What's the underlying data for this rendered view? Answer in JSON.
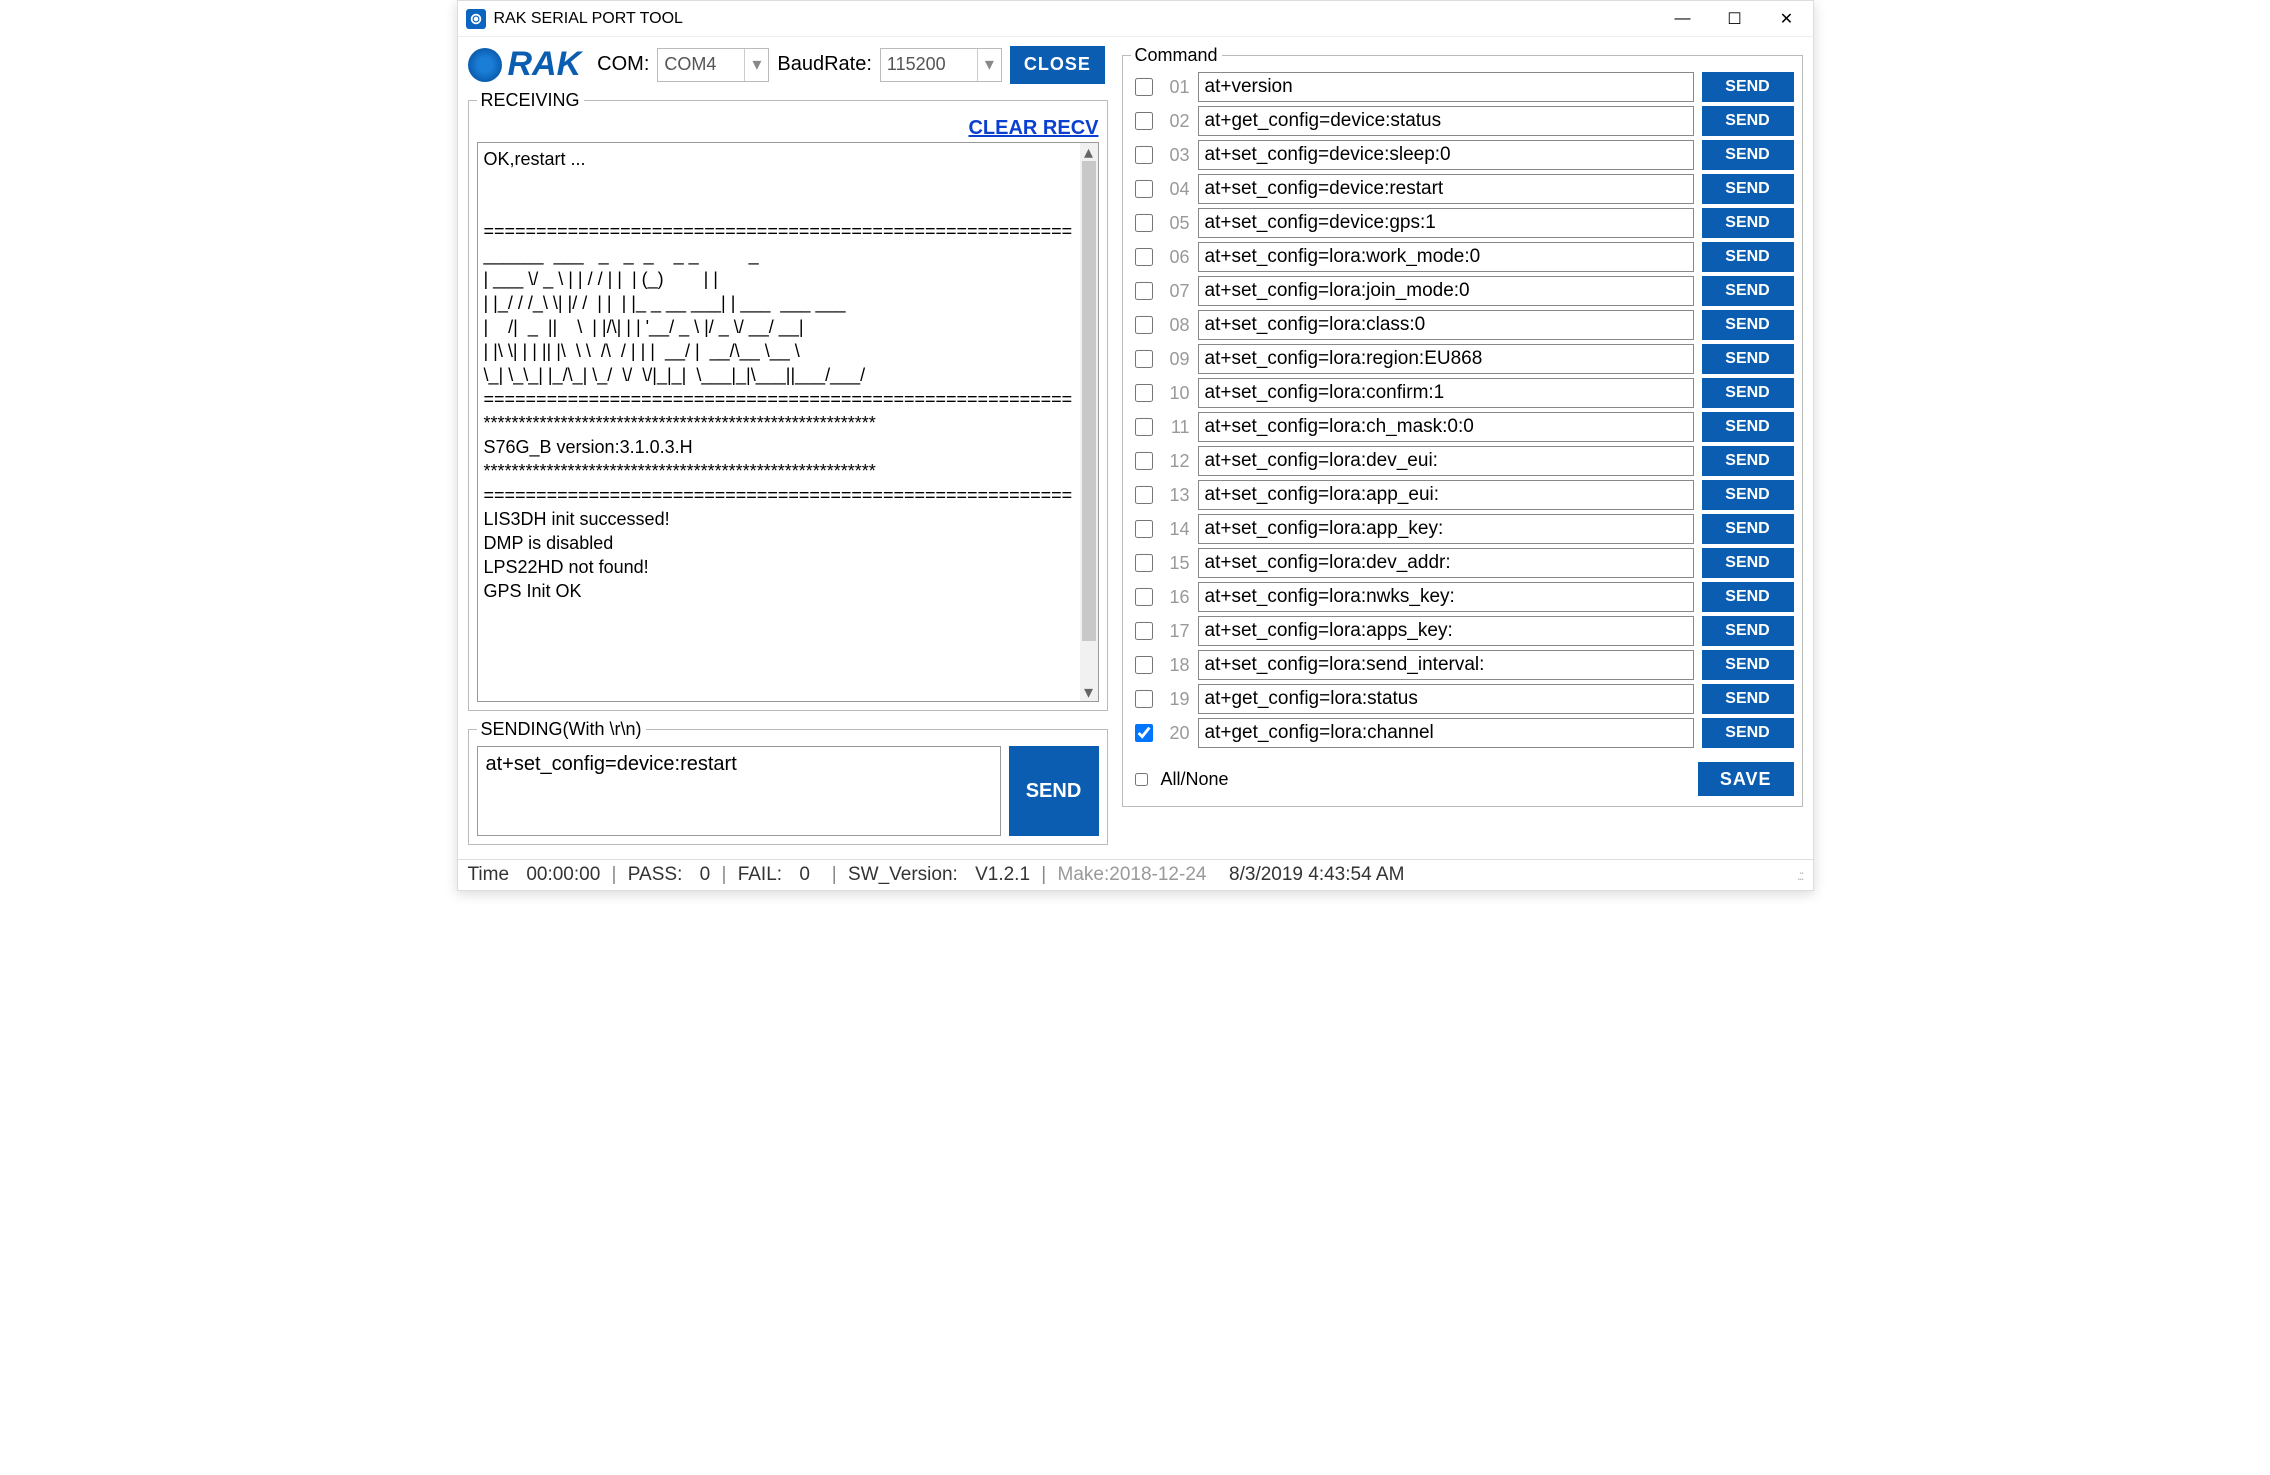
{
  "window": {
    "title": "RAK SERIAL PORT TOOL"
  },
  "toolbar": {
    "logo_text": "RAK",
    "com_label": "COM:",
    "com_value": "COM4",
    "baud_label": "BaudRate:",
    "baud_value": "115200",
    "close_label": "CLOSE"
  },
  "receiving": {
    "legend": "RECEIVING",
    "clear_label": "CLEAR RECV",
    "text": "OK,restart ...\n\n\n========================================================\n______  ___   _   _  _    _ _          _\n| ___ \\/ _ \\ | | / / | |  | (_)        | |\n| |_/ / /_\\ \\| |/ /  | |  | |_ _ __ ___| | ___  ___ ___\n|    /|  _  ||    \\  | |/\\| | | '__/ _ \\ |/ _ \\/ __/ __|\n| |\\ \\| | | || |\\  \\ \\  /\\  / | | |  __/ |  __/\\__ \\__ \\\n\\_| \\_\\_| |_/\\_| \\_/  \\/  \\/|_|_|  \\___|_|\\___||___/___/\n========================================================\n********************************************************\nS76G_B version:3.1.0.3.H\n********************************************************\n========================================================\nLIS3DH init successed!\nDMP is disabled\nLPS22HD not found!\nGPS Init OK"
  },
  "sending": {
    "legend": "SENDING(With \\r\\n)",
    "value": "at+set_config=device:restart",
    "send_label": "SEND"
  },
  "commands": {
    "legend": "Command",
    "send_label": "SEND",
    "all_none_label": "All/None",
    "save_label": "SAVE",
    "items": [
      {
        "n": "01",
        "checked": false,
        "cmd": "at+version"
      },
      {
        "n": "02",
        "checked": false,
        "cmd": "at+get_config=device:status"
      },
      {
        "n": "03",
        "checked": false,
        "cmd": "at+set_config=device:sleep:0"
      },
      {
        "n": "04",
        "checked": false,
        "cmd": "at+set_config=device:restart"
      },
      {
        "n": "05",
        "checked": false,
        "cmd": "at+set_config=device:gps:1"
      },
      {
        "n": "06",
        "checked": false,
        "cmd": "at+set_config=lora:work_mode:0"
      },
      {
        "n": "07",
        "checked": false,
        "cmd": "at+set_config=lora:join_mode:0"
      },
      {
        "n": "08",
        "checked": false,
        "cmd": "at+set_config=lora:class:0"
      },
      {
        "n": "09",
        "checked": false,
        "cmd": "at+set_config=lora:region:EU868"
      },
      {
        "n": "10",
        "checked": false,
        "cmd": "at+set_config=lora:confirm:1"
      },
      {
        "n": "11",
        "checked": false,
        "cmd": "at+set_config=lora:ch_mask:0:0"
      },
      {
        "n": "12",
        "checked": false,
        "cmd": "at+set_config=lora:dev_eui:"
      },
      {
        "n": "13",
        "checked": false,
        "cmd": "at+set_config=lora:app_eui:"
      },
      {
        "n": "14",
        "checked": false,
        "cmd": "at+set_config=lora:app_key:"
      },
      {
        "n": "15",
        "checked": false,
        "cmd": "at+set_config=lora:dev_addr:"
      },
      {
        "n": "16",
        "checked": false,
        "cmd": "at+set_config=lora:nwks_key:"
      },
      {
        "n": "17",
        "checked": false,
        "cmd": "at+set_config=lora:apps_key:"
      },
      {
        "n": "18",
        "checked": false,
        "cmd": "at+set_config=lora:send_interval:"
      },
      {
        "n": "19",
        "checked": false,
        "cmd": "at+get_config=lora:status"
      },
      {
        "n": "20",
        "checked": true,
        "cmd": "at+get_config=lora:channel"
      }
    ]
  },
  "status": {
    "time_label": "Time",
    "time_value": "00:00:00",
    "pass_label": "PASS:",
    "pass_value": "0",
    "fail_label": "FAIL:",
    "fail_value": "0",
    "sw_label": "SW_Version:",
    "sw_value": "V1.2.1",
    "make": "Make:2018-12-24",
    "datetime": "8/3/2019 4:43:54 AM"
  }
}
